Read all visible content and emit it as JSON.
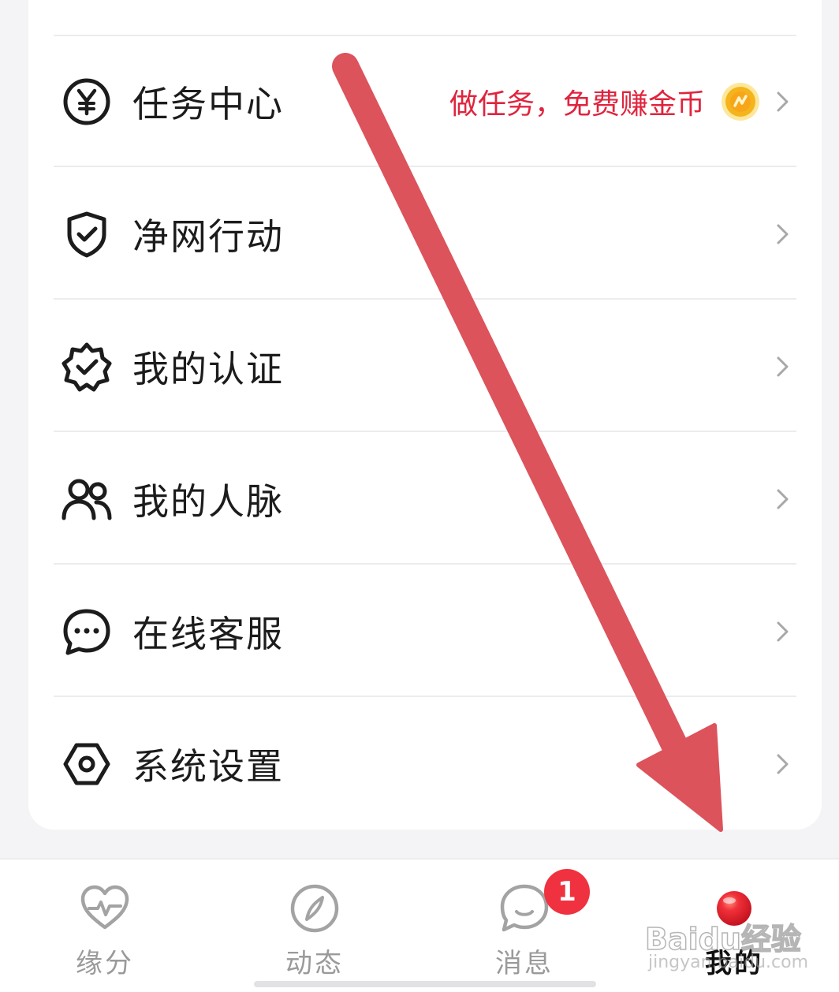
{
  "menu": {
    "items": [
      {
        "label": "任务中心",
        "icon": "yen-coin-icon",
        "promo": "做任务，免费赚金币",
        "promo_icon": "gold-coin-icon"
      },
      {
        "label": "净网行动",
        "icon": "shield-check-icon"
      },
      {
        "label": "我的认证",
        "icon": "verified-badge-icon"
      },
      {
        "label": "我的人脉",
        "icon": "contacts-icon"
      },
      {
        "label": "在线客服",
        "icon": "chat-bubble-icon"
      },
      {
        "label": "系统设置",
        "icon": "settings-hexagon-icon"
      }
    ]
  },
  "tabbar": {
    "tabs": [
      {
        "label": "缘分",
        "icon": "heartbeat-icon",
        "active": false
      },
      {
        "label": "动态",
        "icon": "compass-icon",
        "active": false
      },
      {
        "label": "消息",
        "icon": "message-bubble-icon",
        "active": false,
        "badge": "1"
      },
      {
        "label": "我的",
        "icon": "profile-ball-icon",
        "active": true
      }
    ]
  },
  "watermark": {
    "main": "Baidu经验",
    "sub": "jingyan.baidu.com"
  },
  "colors": {
    "promo": "#e0243e",
    "badge": "#f0313f",
    "arrow": "#dc535b",
    "active_tab_ball": "#e8202a",
    "coin": "#f5b31c",
    "tab_inactive": "#9a9a9a"
  }
}
